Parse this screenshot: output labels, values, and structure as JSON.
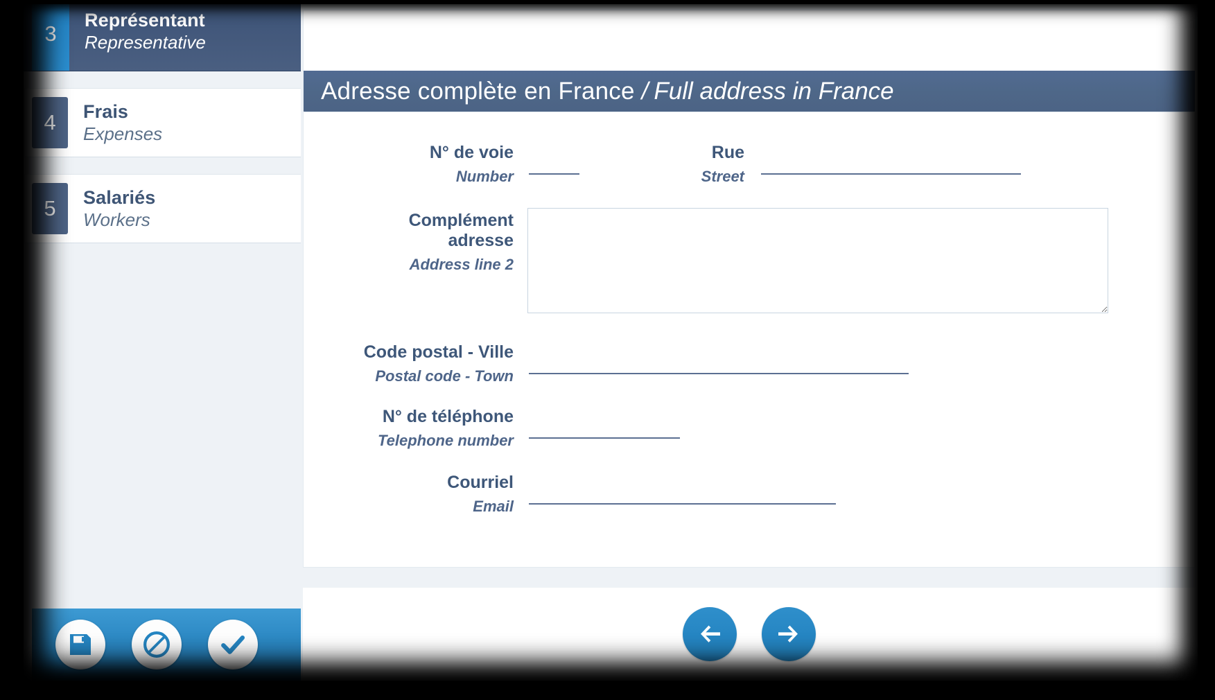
{
  "sidebar": {
    "steps": [
      {
        "number": "3",
        "fr": "Représentant",
        "en": "Representative",
        "active": true
      },
      {
        "number": "4",
        "fr": "Frais",
        "en": "Expenses",
        "active": false
      },
      {
        "number": "5",
        "fr": "Salariés",
        "en": "Workers",
        "active": false
      }
    ],
    "actions": [
      {
        "name": "save-button",
        "icon": "floppy-disk-icon",
        "label": "Enregistrer"
      },
      {
        "name": "cancel-button",
        "icon": "prohibition-icon",
        "label": "Annuler"
      },
      {
        "name": "validate-button",
        "icon": "check-icon",
        "label": "Valider"
      }
    ]
  },
  "panel": {
    "header": {
      "fr": "Adresse complète en France",
      "separator": "/",
      "en": "Full address in France"
    },
    "fields": {
      "street_number": {
        "fr": "N° de voie",
        "en": "Number",
        "value": "",
        "placeholder": ""
      },
      "street": {
        "fr": "Rue",
        "en": "Street",
        "value": "",
        "placeholder": ""
      },
      "address_line2": {
        "fr_line1": "Complément",
        "fr_line2": "adresse",
        "en": "Address line 2",
        "value": "",
        "placeholder": ""
      },
      "postal_town": {
        "fr": "Code postal - Ville",
        "en": "Postal code - Town",
        "value": "",
        "placeholder": ""
      },
      "telephone": {
        "fr": "N° de téléphone",
        "en": "Telephone number",
        "value": "",
        "placeholder": ""
      },
      "email": {
        "fr": "Courriel",
        "en": "Email",
        "value": "",
        "placeholder": ""
      }
    }
  },
  "navigation": {
    "previous_label": "Précédent",
    "next_label": "Suivant"
  },
  "colors": {
    "accent_blue": "#2585c2",
    "header_slate": "#4e6788",
    "label_blue": "#3e5779",
    "page_bg": "#eef2f6"
  }
}
